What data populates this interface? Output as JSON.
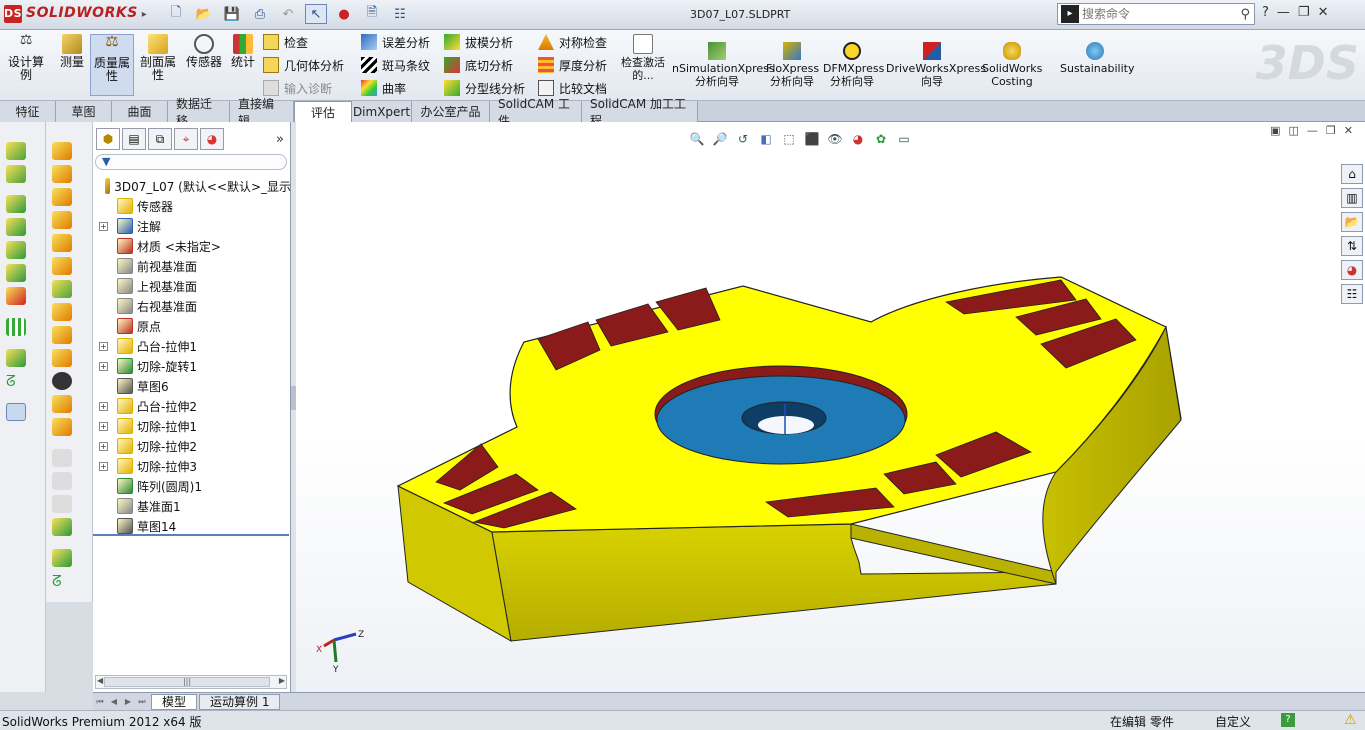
{
  "app": {
    "brand": "SOLIDWORKS",
    "document_title": "3D07_L07.SLDPRT",
    "search_placeholder": "搜索命令"
  },
  "ribbon": {
    "big_buttons": [
      "设计算例",
      "测量",
      "质量属性",
      "剖面属性",
      "传感器",
      "统计"
    ],
    "check_col1": [
      "检查",
      "几何体分析",
      "输入诊断"
    ],
    "check_col2": [
      "误差分析",
      "斑马条纹",
      "曲率"
    ],
    "check_col3": [
      "拔模分析",
      "底切分析",
      "分型线分析"
    ],
    "check_col4": [
      "对称检查",
      "厚度分析",
      "比较文档"
    ],
    "check_active": "检查激活的...",
    "sim_buttons": [
      "nSimulationXpress 分析向导",
      "FloXpress 分析向导",
      "DFMXpress 分析向导",
      "DriveWorksXpress 向导",
      "SolidWorks Costing",
      "Sustainability"
    ]
  },
  "tabs": [
    "特征",
    "草图",
    "曲面",
    "数据迁移",
    "直接编辑",
    "评估",
    "DimXpert",
    "办公室产品",
    "SolidCAM 工件",
    "SolidCAM 加工工程"
  ],
  "active_tab": "评估",
  "tree": {
    "root": "3D07_L07  (默认<<默认>_显示",
    "items": [
      {
        "label": "传感器",
        "expand": false
      },
      {
        "label": "注解",
        "expand": true
      },
      {
        "label": "材质 <未指定>",
        "expand": false
      },
      {
        "label": "前视基准面",
        "expand": false
      },
      {
        "label": "上视基准面",
        "expand": false
      },
      {
        "label": "右视基准面",
        "expand": false
      },
      {
        "label": "原点",
        "expand": false
      },
      {
        "label": "凸台-拉伸1",
        "expand": true
      },
      {
        "label": "切除-旋转1",
        "expand": true
      },
      {
        "label": "草图6",
        "expand": false
      },
      {
        "label": "凸台-拉伸2",
        "expand": true
      },
      {
        "label": "切除-拉伸1",
        "expand": true
      },
      {
        "label": "切除-拉伸2",
        "expand": true
      },
      {
        "label": "切除-拉伸3",
        "expand": true
      },
      {
        "label": "阵列(圆周)1",
        "expand": false
      },
      {
        "label": "基准面1",
        "expand": false
      },
      {
        "label": "草图14",
        "expand": false
      }
    ]
  },
  "bottom_tabs": [
    "模型",
    "运动算例 1"
  ],
  "triad": {
    "x": "X",
    "y": "Y",
    "z": "Z"
  },
  "status": {
    "product": "SolidWorks Premium 2012 x64 版",
    "mode": "在编辑 零件",
    "units": "自定义"
  },
  "colors": {
    "part_yellow": "#ffff00",
    "pocket_red": "#8b1a1a",
    "boss_blue": "#1e7bb5",
    "ribbon_bg": "#eef2f7"
  }
}
